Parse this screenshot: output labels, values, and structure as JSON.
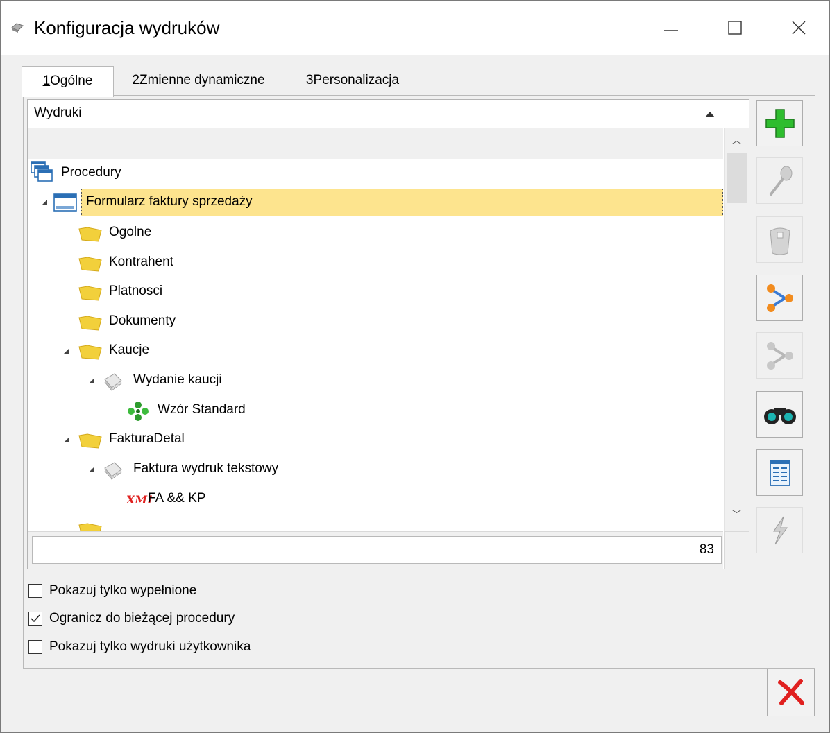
{
  "window": {
    "title": "Konfiguracja wydruków",
    "icons": {
      "app": "app-icon",
      "minimize": "minimize-icon",
      "maximize": "maximize-icon",
      "close": "close-icon"
    }
  },
  "tabs": [
    {
      "accel": "1",
      "label": "Ogólne",
      "active": true
    },
    {
      "accel": "2",
      "label": "Zmienne dynamiczne",
      "active": false
    },
    {
      "accel": "3",
      "label": "Personalizacja",
      "active": false
    }
  ],
  "grid": {
    "column_header": "Wydruki",
    "sort": "ascending",
    "count": "83",
    "tree": [
      {
        "label": "Procedury",
        "icon": "windows-icon",
        "level": 0,
        "expander": false
      },
      {
        "label": "Formularz faktury sprzedaży",
        "icon": "form-icon",
        "level": 1,
        "expander": true,
        "selected": true
      },
      {
        "label": "Ogolne",
        "icon": "folder-icon",
        "level": 2,
        "expander": false
      },
      {
        "label": "Kontrahent",
        "icon": "folder-icon",
        "level": 2,
        "expander": false
      },
      {
        "label": "Platnosci",
        "icon": "folder-icon",
        "level": 2,
        "expander": false
      },
      {
        "label": "Dokumenty",
        "icon": "folder-icon",
        "level": 2,
        "expander": false
      },
      {
        "label": "Kaucje",
        "icon": "folder-icon",
        "level": 2,
        "expander": true
      },
      {
        "label": "Wydanie kaucji",
        "icon": "pages-icon",
        "level": 3,
        "expander": true
      },
      {
        "label": "Wzór Standard",
        "icon": "clover-icon",
        "level": 4,
        "expander": false
      },
      {
        "label": "FakturaDetal",
        "icon": "folder-icon",
        "level": 2,
        "expander": true
      },
      {
        "label": "Faktura wydruk tekstowy",
        "icon": "pages-icon",
        "level": 3,
        "expander": true
      },
      {
        "label": "FA && KP",
        "icon": "xml-icon",
        "level": 4,
        "expander": false
      }
    ]
  },
  "toolbar": [
    {
      "name": "add-button",
      "icon": "plus-icon",
      "enabled": true
    },
    {
      "name": "edit-button",
      "icon": "spoon-icon",
      "enabled": false
    },
    {
      "name": "delete-button",
      "icon": "trash-icon",
      "enabled": false
    },
    {
      "name": "copy-button",
      "icon": "molecule-icon",
      "enabled": true
    },
    {
      "name": "copy-disabled-button",
      "icon": "molecule-gray-icon",
      "enabled": false
    },
    {
      "name": "preview-button",
      "icon": "binoculars-icon",
      "enabled": true
    },
    {
      "name": "properties-button",
      "icon": "form-list-icon",
      "enabled": true
    },
    {
      "name": "run-button",
      "icon": "lightning-icon",
      "enabled": false
    }
  ],
  "checkboxes": [
    {
      "label": "Pokazuj tylko wypełnione",
      "checked": false
    },
    {
      "label": "Ogranicz do bieżącej procedury",
      "checked": true
    },
    {
      "label": "Pokazuj tylko wydruki użytkownika",
      "checked": false
    }
  ],
  "close_button": {
    "icon": "red-x-icon"
  },
  "colors": {
    "selection": "#fde48e",
    "add": "#2ebd2e",
    "close": "#e0201f",
    "folder": "#f2d03b"
  }
}
